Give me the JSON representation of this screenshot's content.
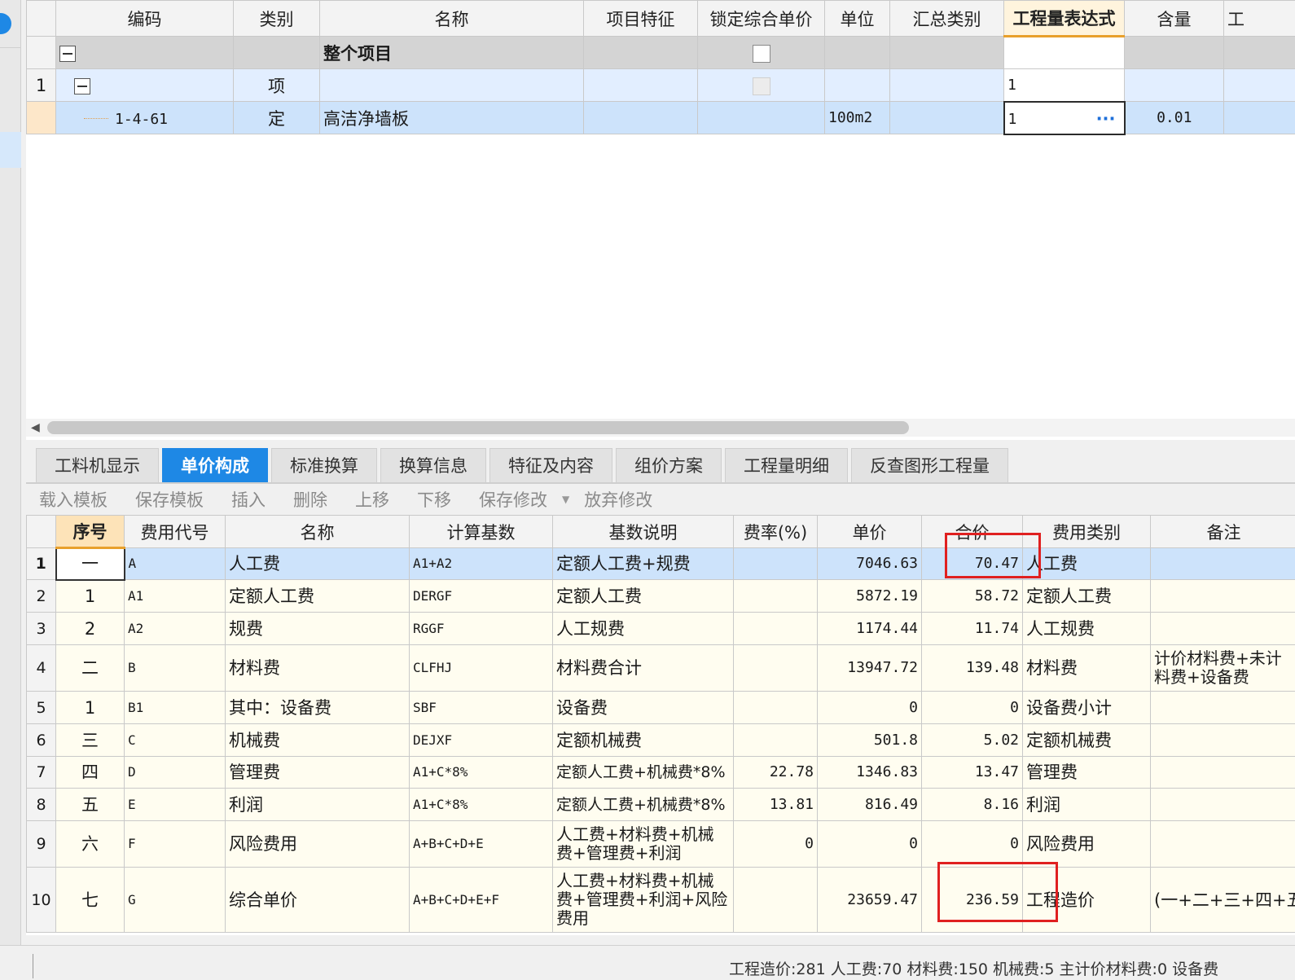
{
  "top_grid": {
    "columns": [
      "编码",
      "类别",
      "名称",
      "项目特征",
      "锁定综合单价",
      "单位",
      "汇总类别",
      "工程量表达式",
      "含量",
      "工"
    ],
    "rows": [
      {
        "rownum": "",
        "code": "",
        "type": "",
        "name": "整个项目",
        "feature": "",
        "unit": "",
        "summary": "",
        "expr": "",
        "content": ""
      },
      {
        "rownum": "1",
        "code": "",
        "type": "项",
        "name": "",
        "feature": "",
        "unit": "",
        "summary": "",
        "expr": "1",
        "content": ""
      },
      {
        "rownum": "",
        "code": "1-4-61",
        "type": "定",
        "name": "高洁净墙板",
        "feature": "",
        "unit": "100m2",
        "summary": "",
        "expr": "1",
        "content": "0.01"
      }
    ]
  },
  "tabs": [
    "工料机显示",
    "单价构成",
    "标准换算",
    "换算信息",
    "特征及内容",
    "组价方案",
    "工程量明细",
    "反查图形工程量"
  ],
  "active_tab": "单价构成",
  "toolbar": {
    "load_template": "载入模板",
    "save_template": "保存模板",
    "insert": "插入",
    "delete": "删除",
    "move_up": "上移",
    "move_down": "下移",
    "save_changes": "保存修改",
    "discard_changes": "放弃修改"
  },
  "bottom_grid": {
    "columns": [
      "序号",
      "费用代号",
      "名称",
      "计算基数",
      "基数说明",
      "费率(%)",
      "单价",
      "合价",
      "费用类别",
      "备注"
    ],
    "rows": [
      {
        "rownum": "1",
        "seq": "一",
        "code": "A",
        "name": "人工费",
        "base": "A1+A2",
        "desc": "定额人工费+规费",
        "rate": "",
        "price": "7046.63",
        "total": "70.47",
        "category": "人工费",
        "note": ""
      },
      {
        "rownum": "2",
        "seq": "1",
        "code": "A1",
        "name": "定额人工费",
        "base": "DERGF",
        "desc": "定额人工费",
        "rate": "",
        "price": "5872.19",
        "total": "58.72",
        "category": "定额人工费",
        "note": ""
      },
      {
        "rownum": "3",
        "seq": "2",
        "code": "A2",
        "name": "规费",
        "base": "RGGF",
        "desc": "人工规费",
        "rate": "",
        "price": "1174.44",
        "total": "11.74",
        "category": "人工规费",
        "note": ""
      },
      {
        "rownum": "4",
        "seq": "二",
        "code": "B",
        "name": "材料费",
        "base": "CLFHJ",
        "desc": "材料费合计",
        "rate": "",
        "price": "13947.72",
        "total": "139.48",
        "category": "材料费",
        "note": "计价材料费+未计料费+设备费"
      },
      {
        "rownum": "5",
        "seq": "1",
        "code": "B1",
        "name": "其中：设备费",
        "base": "SBF",
        "desc": "设备费",
        "rate": "",
        "price": "0",
        "total": "0",
        "category": "设备费小计",
        "note": ""
      },
      {
        "rownum": "6",
        "seq": "三",
        "code": "C",
        "name": "机械费",
        "base": "DEJXF",
        "desc": "定额机械费",
        "rate": "",
        "price": "501.8",
        "total": "5.02",
        "category": "定额机械费",
        "note": ""
      },
      {
        "rownum": "7",
        "seq": "四",
        "code": "D",
        "name": "管理费",
        "base": "A1+C*8%",
        "desc": "定额人工费+机械费*8%",
        "rate": "22.78",
        "price": "1346.83",
        "total": "13.47",
        "category": "管理费",
        "note": ""
      },
      {
        "rownum": "8",
        "seq": "五",
        "code": "E",
        "name": "利润",
        "base": "A1+C*8%",
        "desc": "定额人工费+机械费*8%",
        "rate": "13.81",
        "price": "816.49",
        "total": "8.16",
        "category": "利润",
        "note": ""
      },
      {
        "rownum": "9",
        "seq": "六",
        "code": "F",
        "name": "风险费用",
        "base": "A+B+C+D+E",
        "desc": "人工费+材料费+机械费+管理费+利润",
        "rate": "0",
        "price": "0",
        "total": "0",
        "category": "风险费用",
        "note": ""
      },
      {
        "rownum": "10",
        "seq": "七",
        "code": "G",
        "name": "综合单价",
        "base": "A+B+C+D+E+F",
        "desc": "人工费+材料费+机械费+管理费+利润+风险费用",
        "rate": "",
        "price": "23659.47",
        "total": "236.59",
        "category": "工程造价",
        "note": "(一+二+三+四+五"
      }
    ]
  },
  "status_bar": "工程造价:281  人工费:70  材料费:150  机械费:5  主计价材料费:0  设备费",
  "colors": {
    "accent": "#1e88e5",
    "highlight": "#e02020",
    "selected_row": "#cde3fb",
    "header_active": "#e8a02c"
  }
}
